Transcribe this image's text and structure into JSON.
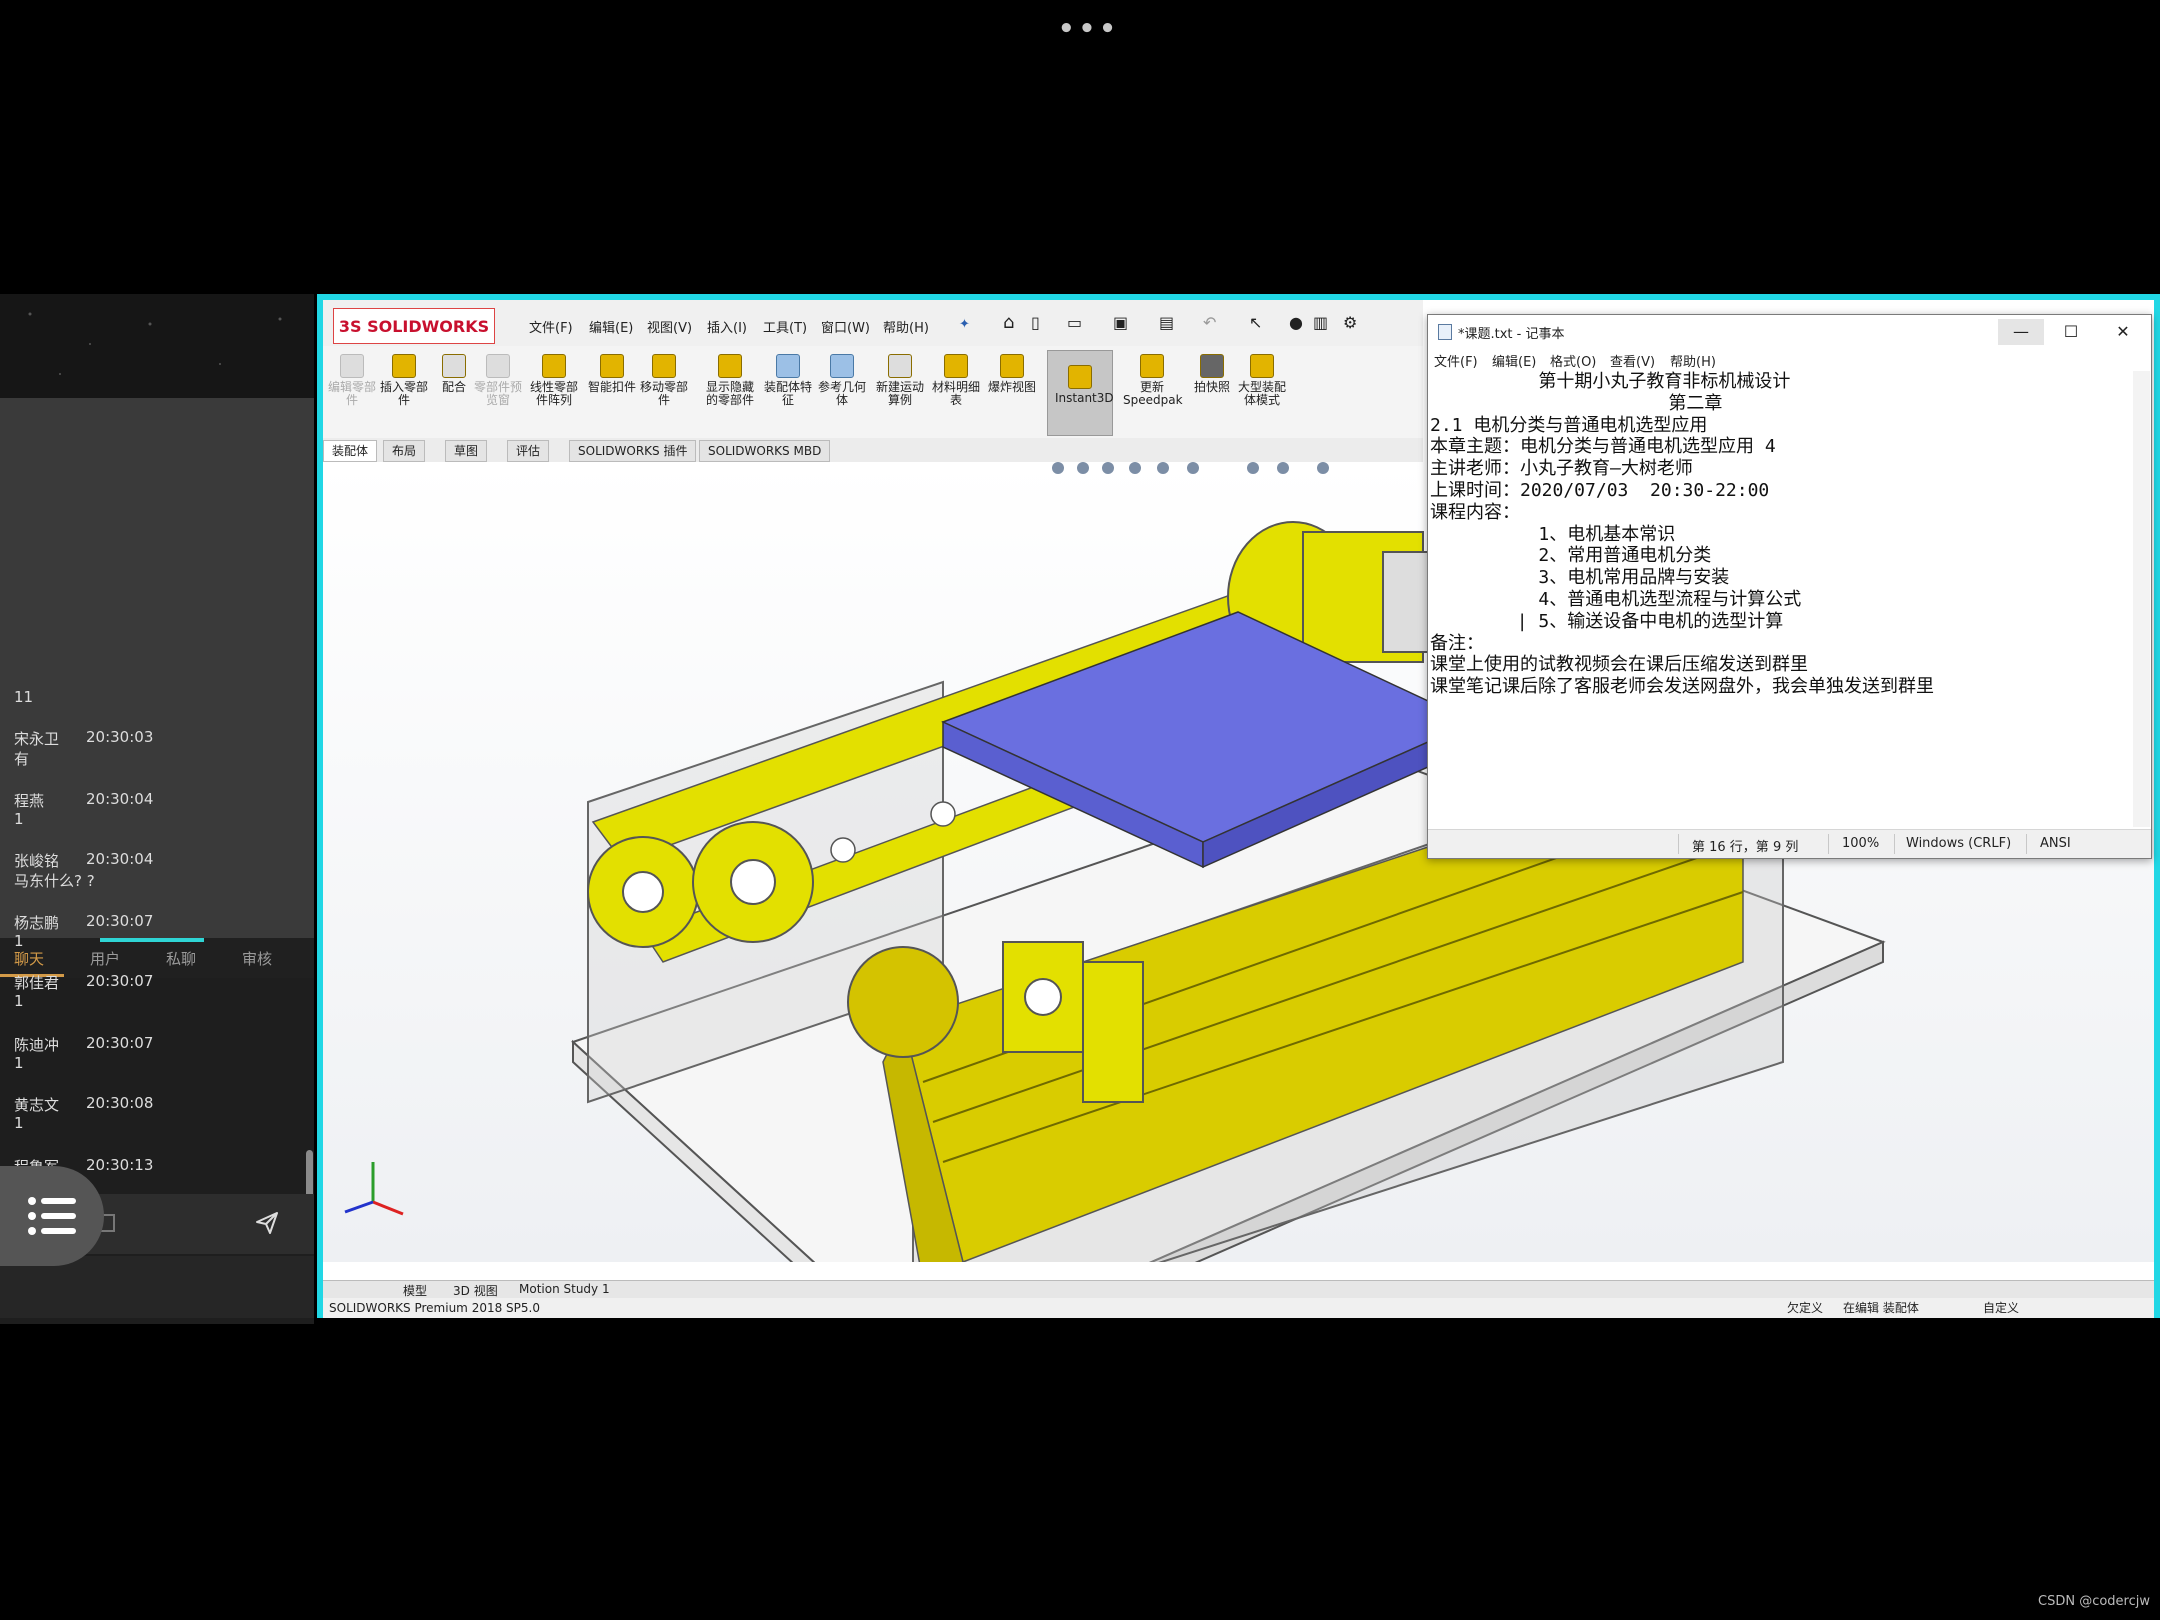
{
  "top_indicator": "•••",
  "chat": {
    "tabs": [
      "聊天",
      "用户",
      "私聊",
      "审核"
    ],
    "first_line": "11",
    "messages": [
      {
        "name": "宋永卫",
        "time": "20:30:03",
        "text": "有"
      },
      {
        "name": "程燕",
        "time": "20:30:04",
        "text": "1"
      },
      {
        "name": "张峻铭",
        "time": "20:30:04",
        "text": "马东什么? ?"
      },
      {
        "name": "杨志鹏",
        "time": "20:30:07",
        "text": "1"
      },
      {
        "name": "郭佳君",
        "time": "20:30:07",
        "text": "1"
      },
      {
        "name": "陈迪冲",
        "time": "20:30:07",
        "text": "1"
      },
      {
        "name": "黄志文",
        "time": "20:30:08",
        "text": "1"
      },
      {
        "name": "程鲁军",
        "time": "20:30:13",
        "text": ""
      }
    ]
  },
  "solidworks": {
    "logo": "3S SOLIDWORKS",
    "menus": [
      "文件(F)",
      "编辑(E)",
      "视图(V)",
      "插入(I)",
      "工具(T)",
      "窗口(W)",
      "帮助(H)"
    ],
    "ribbon": [
      {
        "label": "编辑零部件",
        "enabled": false
      },
      {
        "label": "插入零部件",
        "enabled": true
      },
      {
        "label": "配合",
        "enabled": true
      },
      {
        "label": "零部件预览窗",
        "enabled": false
      },
      {
        "label": "线性零部件阵列",
        "enabled": true
      },
      {
        "label": "智能扣件",
        "enabled": true
      },
      {
        "label": "移动零部件",
        "enabled": true
      },
      {
        "label": "显示隐藏的零部件",
        "enabled": true
      },
      {
        "label": "装配体特征",
        "enabled": true
      },
      {
        "label": "参考几何体",
        "enabled": true
      },
      {
        "label": "新建运动算例",
        "enabled": true
      },
      {
        "label": "材料明细表",
        "enabled": true
      },
      {
        "label": "爆炸视图",
        "enabled": true
      },
      {
        "label": "Instant3D",
        "enabled": true
      },
      {
        "label": "更新Speedpak",
        "enabled": true
      },
      {
        "label": "拍快照",
        "enabled": true
      },
      {
        "label": "大型装配体模式",
        "enabled": true
      }
    ],
    "command_tabs": [
      "装配体",
      "布局",
      "草图",
      "评估",
      "SOLIDWORKS 插件",
      "SOLIDWORKS MBD"
    ],
    "bottom_tabs": [
      "模型",
      "3D 视图",
      "Motion Study 1"
    ],
    "status_left": "SOLIDWORKS Premium 2018 SP5.0",
    "status_items": [
      "欠定义",
      "在编辑 装配体",
      "自定义"
    ],
    "colors": {
      "frame": "#21d7e5",
      "part_yellow": "#e3e000",
      "plate_blue": "#6a6fe0"
    }
  },
  "notepad": {
    "title": "*课题.txt - 记事本",
    "menus": [
      "文件(F)",
      "编辑(E)",
      "格式(O)",
      "查看(V)",
      "帮助(H)"
    ],
    "lines": [
      "          第十期小丸子教育非标机械设计",
      "                      第二章",
      "",
      "2.1 电机分类与普通电机选型应用",
      "",
      "本章主题：电机分类与普通电机选型应用 4",
      "主讲老师：小丸子教育—大树老师",
      "上课时间：2020/07/03  20:30-22:00",
      "",
      "课程内容：",
      "",
      "          1、电机基本常识",
      "          2、常用普通电机分类",
      "          3、电机常用品牌与安装",
      "          4、普通电机选型流程与计算公式",
      "        | 5、输送设备中电机的选型计算",
      "",
      "备注：",
      "课堂上使用的试教视频会在课后压缩发送到群里",
      "课堂笔记课后除了客服老师会发送网盘外，我会单独发送到群里"
    ],
    "status": {
      "position": "第 16 行，第 9 列",
      "zoom": "100%",
      "eol": "Windows (CRLF)",
      "encoding": "ANSI"
    }
  },
  "watermark": "CSDN @codercjw"
}
